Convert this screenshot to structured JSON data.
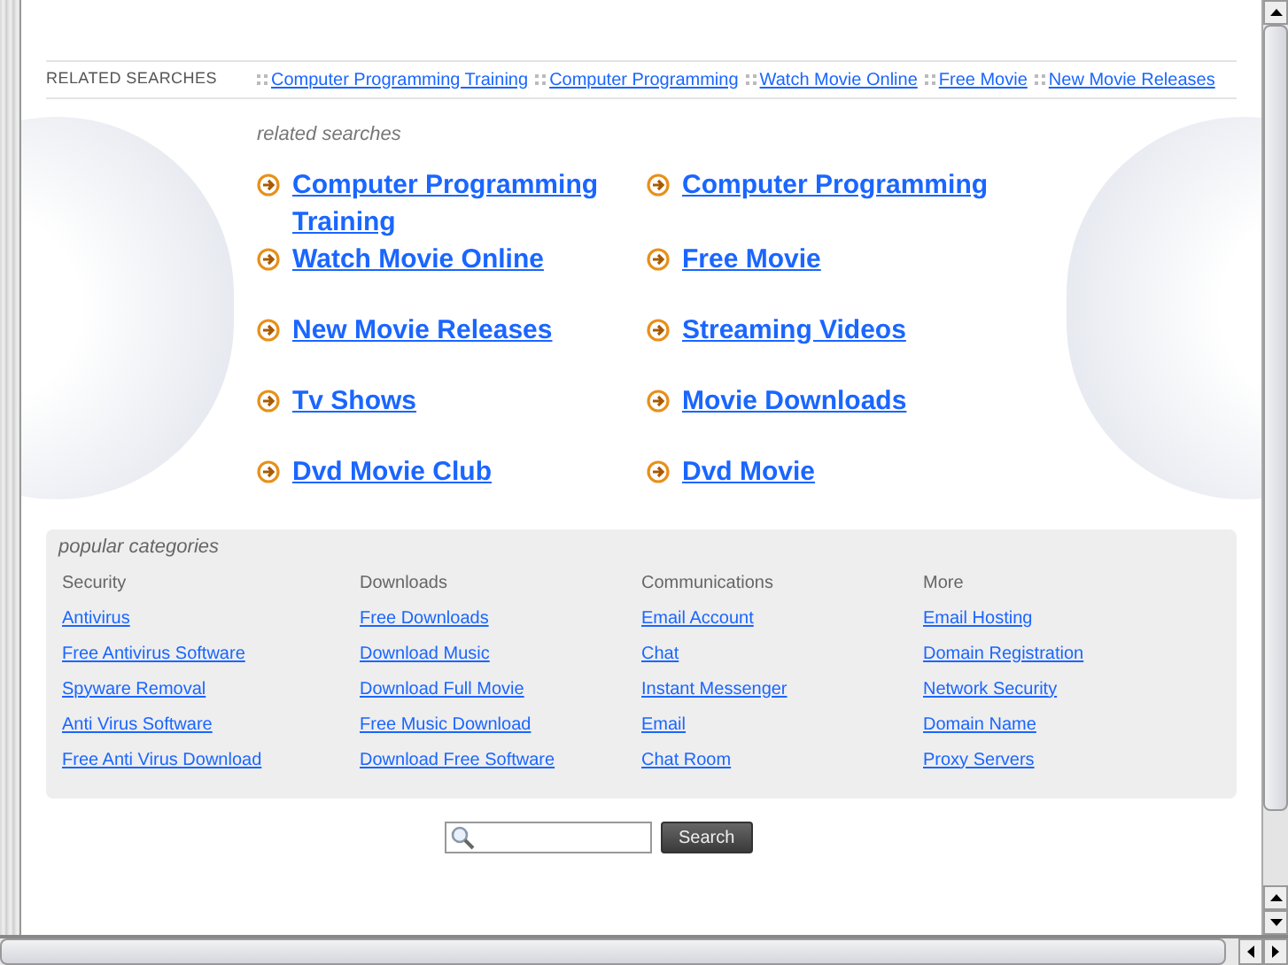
{
  "related_bar": {
    "label": "RELATED SEARCHES",
    "links": [
      "Computer Programming Training",
      "Computer Programming",
      "Watch Movie Online",
      "Free Movie",
      "New Movie Releases"
    ]
  },
  "related_searches": {
    "heading": "related searches",
    "links": [
      "Computer Programming Training",
      "Computer Programming",
      "Watch Movie Online",
      "Free Movie",
      "New Movie Releases",
      "Streaming Videos",
      "Tv Shows",
      "Movie Downloads",
      "Dvd Movie Club",
      "Dvd Movie"
    ]
  },
  "popular_categories": {
    "heading": "popular categories",
    "columns": [
      {
        "title": "Security",
        "links": [
          "Antivirus",
          "Free Antivirus Software",
          "Spyware Removal",
          "Anti Virus Software",
          "Free Anti Virus Download"
        ]
      },
      {
        "title": "Downloads",
        "links": [
          "Free Downloads",
          "Download Music",
          "Download Full Movie",
          "Free Music Download",
          "Download Free Software"
        ]
      },
      {
        "title": "Communications",
        "links": [
          "Email Account",
          "Chat",
          "Instant Messenger",
          "Email",
          "Chat Room"
        ]
      },
      {
        "title": "More",
        "links": [
          "Email Hosting",
          "Domain Registration",
          "Network Security",
          "Domain Name",
          "Proxy Servers"
        ]
      }
    ]
  },
  "search": {
    "button": "Search"
  }
}
